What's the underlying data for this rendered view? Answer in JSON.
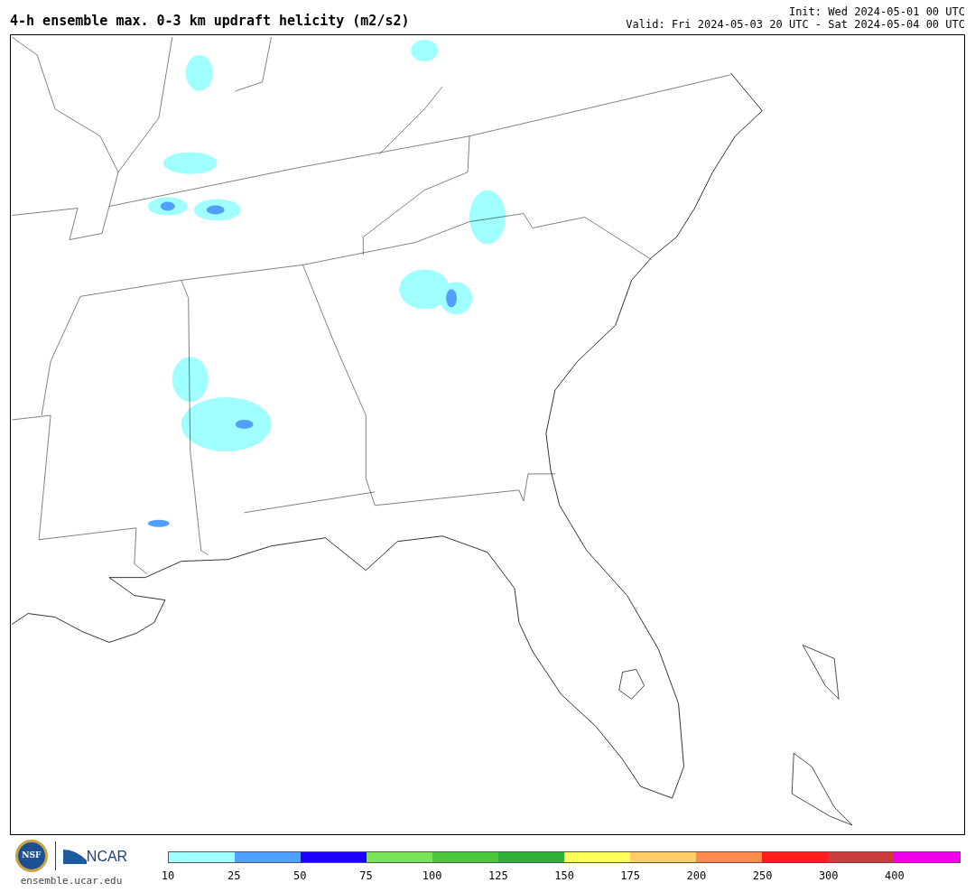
{
  "title": "4-h ensemble max. 0-3 km updraft helicity (m2/s2)",
  "init": "Init: Wed 2024-05-01 00 UTC",
  "valid": "Valid: Fri 2024-05-03 20 UTC - Sat 2024-05-04 00 UTC",
  "logos": {
    "nsf": "NSF",
    "ncar": "NCAR",
    "site": "ensemble.ucar.edu"
  },
  "legend": [
    {
      "label": "10",
      "color": "#a0ffff"
    },
    {
      "label": "25",
      "color": "#50a0ff"
    },
    {
      "label": "50",
      "color": "#1e00ff"
    },
    {
      "label": "75",
      "color": "#7ae35a"
    },
    {
      "label": "100",
      "color": "#4cc83f"
    },
    {
      "label": "125",
      "color": "#2faf37"
    },
    {
      "label": "150",
      "color": "#ffff5a"
    },
    {
      "label": "175",
      "color": "#ffcc66"
    },
    {
      "label": "200",
      "color": "#ff8a4e"
    },
    {
      "label": "250",
      "color": "#ff1c1c"
    },
    {
      "label": "300",
      "color": "#cc3c3c"
    },
    {
      "label": "400",
      "color": "#ee00ee"
    }
  ]
}
